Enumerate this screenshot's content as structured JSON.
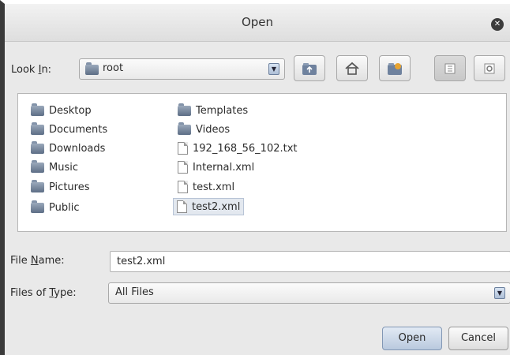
{
  "window": {
    "title": "Open"
  },
  "lookin": {
    "label_pre": "Look ",
    "label_mnemonic": "I",
    "label_post": "n:",
    "value": "root"
  },
  "toolbar": {
    "buttons": [
      {
        "name": "up-one-level-button",
        "icon": "folder-up-icon"
      },
      {
        "name": "home-button",
        "icon": "home-icon"
      },
      {
        "name": "new-folder-button",
        "icon": "new-folder-icon"
      },
      {
        "name": "list-view-button",
        "icon": "list-view-icon"
      },
      {
        "name": "details-view-button",
        "icon": "details-view-icon"
      }
    ]
  },
  "files": {
    "column1": [
      {
        "name": "Desktop",
        "type": "folder"
      },
      {
        "name": "Documents",
        "type": "folder"
      },
      {
        "name": "Downloads",
        "type": "folder"
      },
      {
        "name": "Music",
        "type": "folder"
      },
      {
        "name": "Pictures",
        "type": "folder"
      },
      {
        "name": "Public",
        "type": "folder"
      }
    ],
    "column2": [
      {
        "name": "Templates",
        "type": "folder"
      },
      {
        "name": "Videos",
        "type": "folder"
      },
      {
        "name": "192_168_56_102.txt",
        "type": "file"
      },
      {
        "name": "Internal.xml",
        "type": "file"
      },
      {
        "name": "test.xml",
        "type": "file"
      },
      {
        "name": "test2.xml",
        "type": "file",
        "selected": true
      }
    ]
  },
  "filename": {
    "label_pre": "File ",
    "label_mnemonic": "N",
    "label_post": "ame:",
    "value": "test2.xml"
  },
  "filetype": {
    "label_pre": "Files of ",
    "label_mnemonic": "T",
    "label_post": "ype:",
    "value": "All Files"
  },
  "actions": {
    "open": "Open",
    "cancel": "Cancel"
  }
}
